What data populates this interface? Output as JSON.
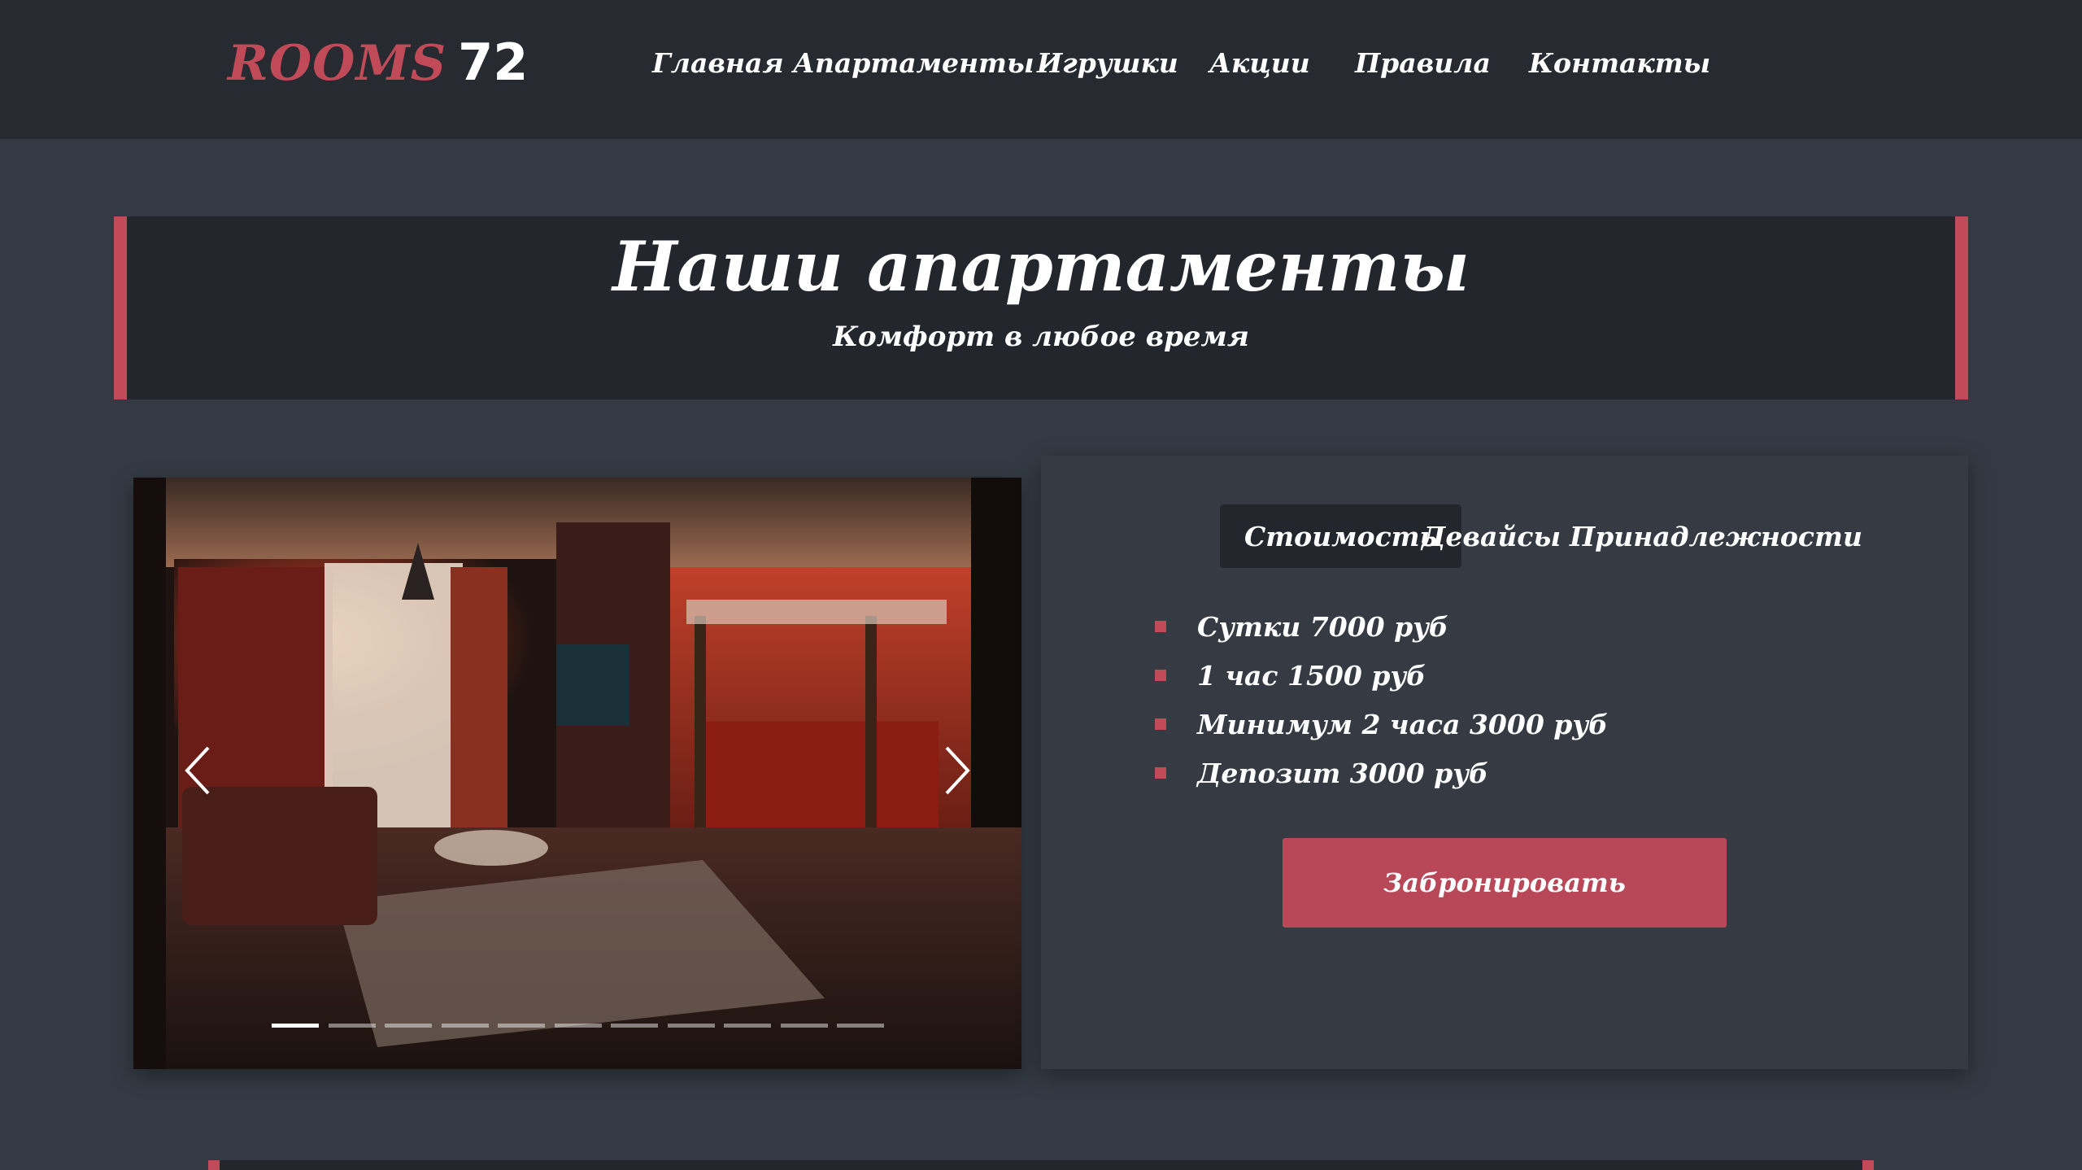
{
  "brand": {
    "name": "ROOMS",
    "number": "72"
  },
  "nav": {
    "items": [
      {
        "label": "Главная"
      },
      {
        "label": "Апартаменты"
      },
      {
        "label": "Игрушки"
      },
      {
        "label": "Акции"
      },
      {
        "label": "Правила"
      },
      {
        "label": "Контакты"
      }
    ]
  },
  "hero": {
    "title": "Наши апартаменты",
    "subtitle": "Комфорт в любое время"
  },
  "gallery": {
    "slide_count": 11,
    "active_slide": 1
  },
  "tabs": [
    {
      "label": "Стоимость",
      "active": true
    },
    {
      "label": "Девайсы",
      "active": false
    },
    {
      "label": "Принадлежности",
      "active": false
    }
  ],
  "prices": [
    {
      "text": "Сутки 7000 руб"
    },
    {
      "text": "1 час 1500 руб"
    },
    {
      "text": "Минимум 2 часа 3000 руб"
    },
    {
      "text": "Депозит 3000 руб"
    }
  ],
  "book_button": {
    "label": "Забронировать"
  },
  "colors": {
    "accent": "#c04a58",
    "header_bg": "#272a31",
    "page_bg": "#343a43",
    "banner_bg": "#23262c"
  }
}
